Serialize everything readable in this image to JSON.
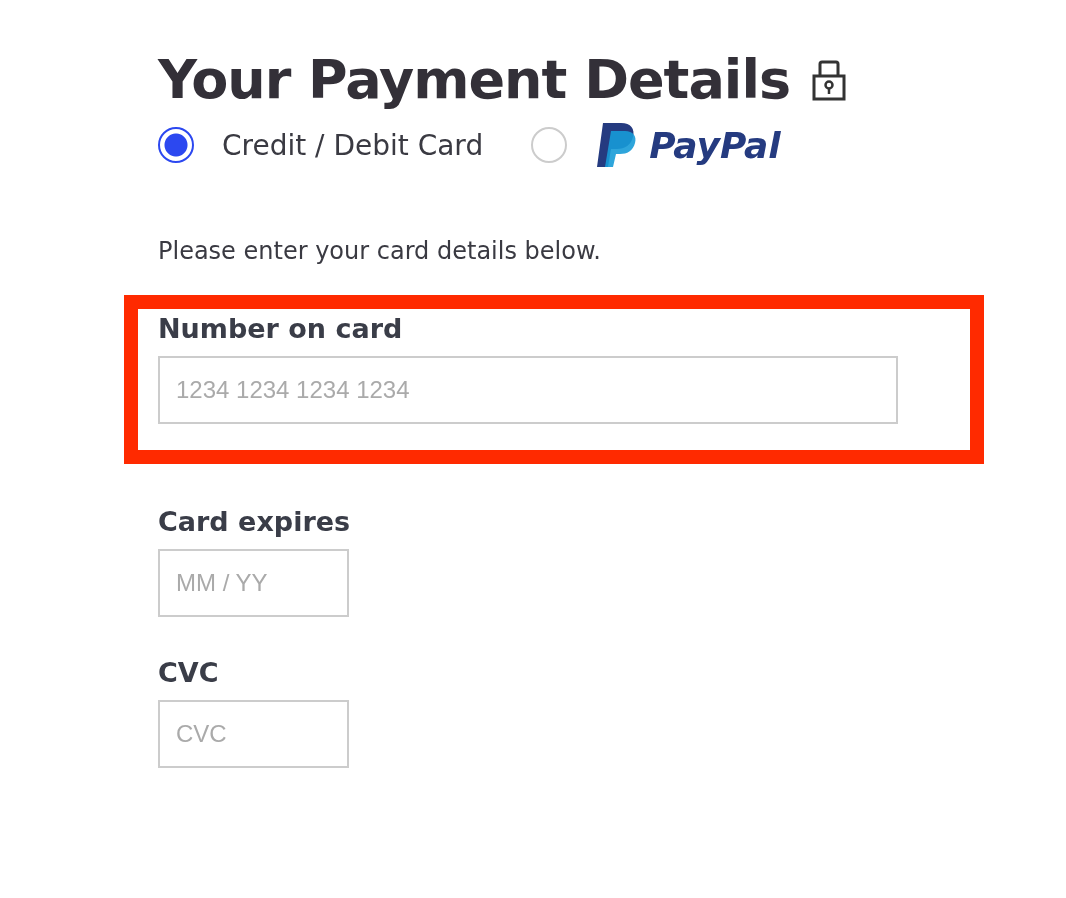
{
  "title": "Your Payment Details",
  "payment_methods": [
    {
      "kind": "card",
      "label": "Credit / Debit Card",
      "selected": true
    },
    {
      "kind": "paypal",
      "label": "PayPal",
      "selected": false
    }
  ],
  "instructions": "Please enter your card details below.",
  "fields": [
    {
      "label": "Number on card",
      "placeholder": "1234 1234 1234 1234",
      "kind": "wide",
      "highlighted": true
    },
    {
      "label": "Card expires",
      "placeholder": "MM / YY",
      "kind": "short",
      "highlighted": false
    },
    {
      "label": "CVC",
      "placeholder": "CVC",
      "kind": "short",
      "highlighted": false
    }
  ]
}
